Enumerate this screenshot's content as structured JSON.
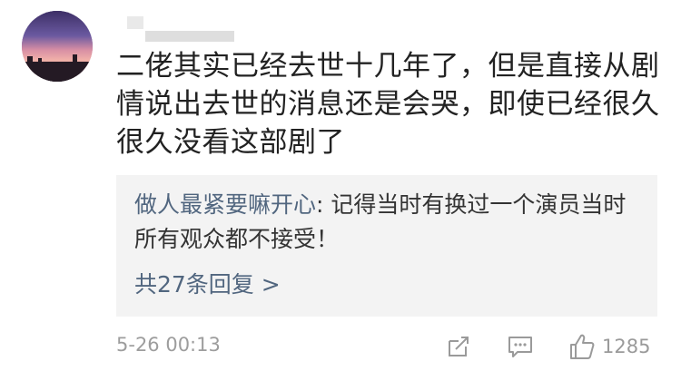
{
  "comment": {
    "text": "二佬其实已经去世十几年了，但是直接从剧情说出去世的消息还是会哭，即使已经很久很久没看这部剧了"
  },
  "reply": {
    "author": "做人最紧要嘛开心",
    "separator": ": ",
    "text": "记得当时有换过一个演员当时所有观众都不接受！",
    "count_label": "共27条回复 >"
  },
  "footer": {
    "timestamp": "5-26 00:13",
    "like_count": "1285"
  },
  "icons": {
    "share": "share-icon",
    "comment": "comment-icon",
    "like": "thumbs-up-icon"
  }
}
